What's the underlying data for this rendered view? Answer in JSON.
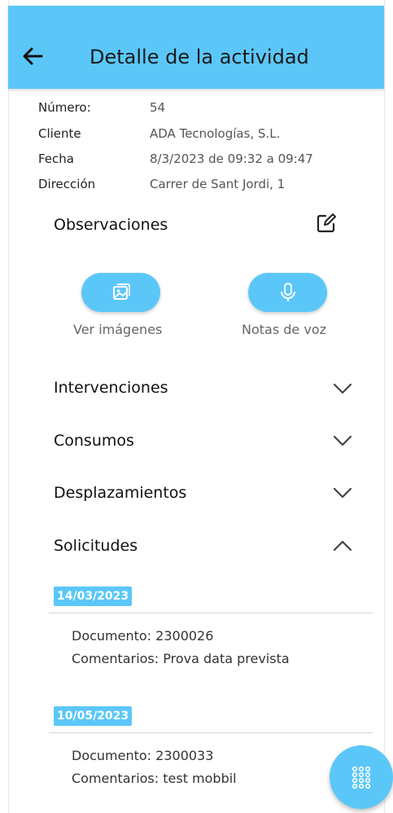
{
  "header": {
    "title": "Detalle de la actividad"
  },
  "info": [
    {
      "label": "Número:",
      "value": "54"
    },
    {
      "label": "Cliente",
      "value": "ADA Tecnologías, S.L."
    },
    {
      "label": "Fecha",
      "value": "8/3/2023 de 09:32 a 09:47"
    },
    {
      "label": "Dirección",
      "value": "Carrer de Sant Jordi, 1"
    }
  ],
  "observations": {
    "title": "Observaciones"
  },
  "actions": {
    "images_label": "Ver imágenes",
    "voice_label": "Notas de voz"
  },
  "sections": {
    "interventions": "Intervenciones",
    "consumptions": "Consumos",
    "trips": "Desplazamientos",
    "requests": "Solicitudes"
  },
  "requests": [
    {
      "date": "14/03/2023",
      "document": "Documento: 2300026",
      "comments": "Comentarios: Prova data prevista"
    },
    {
      "date": "10/05/2023",
      "document": "Documento: 2300033",
      "comments": "Comentarios: test mobbil"
    }
  ],
  "colors": {
    "primary": "#5bc7f8"
  },
  "icons": {
    "back": "arrow-left-icon",
    "edit": "edit-icon",
    "images": "image-icon",
    "voice": "microphone-icon",
    "expand": "chevron-down-icon",
    "collapse": "chevron-up-icon",
    "fab": "grid-dots-icon"
  }
}
